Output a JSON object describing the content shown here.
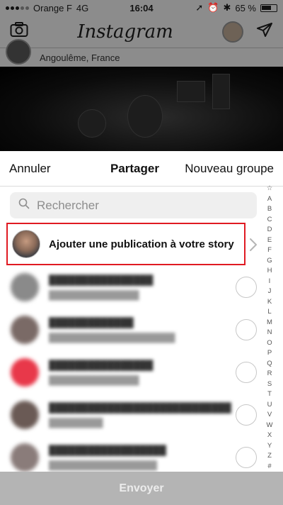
{
  "status_bar": {
    "carrier": "Orange F",
    "network": "4G",
    "time": "16:04",
    "battery": "65 %"
  },
  "app": {
    "title": "Instagram"
  },
  "post": {
    "location": "Angoulême, France"
  },
  "share_sheet": {
    "cancel_label": "Annuler",
    "title": "Partager",
    "new_group_label": "Nouveau groupe",
    "search_placeholder": "Rechercher",
    "story_label": "Ajouter une publication à votre story",
    "send_label": "Envoyer",
    "highlight_color": "#e01a22",
    "alphabet_index": [
      "☆",
      "A",
      "B",
      "C",
      "D",
      "E",
      "F",
      "G",
      "H",
      "I",
      "J",
      "K",
      "L",
      "M",
      "N",
      "O",
      "P",
      "Q",
      "R",
      "S",
      "T",
      "U",
      "V",
      "W",
      "X",
      "Y",
      "Z",
      "#"
    ],
    "contacts": [
      {
        "name": "",
        "avatar_color": "#8a8a8a"
      },
      {
        "name": "",
        "avatar_color": "#7a6a66"
      },
      {
        "name": "",
        "avatar_color": "#e8384a"
      },
      {
        "name": "",
        "avatar_color": "#6a5a55"
      },
      {
        "name": "",
        "avatar_color": "#8a7c7a"
      }
    ]
  }
}
